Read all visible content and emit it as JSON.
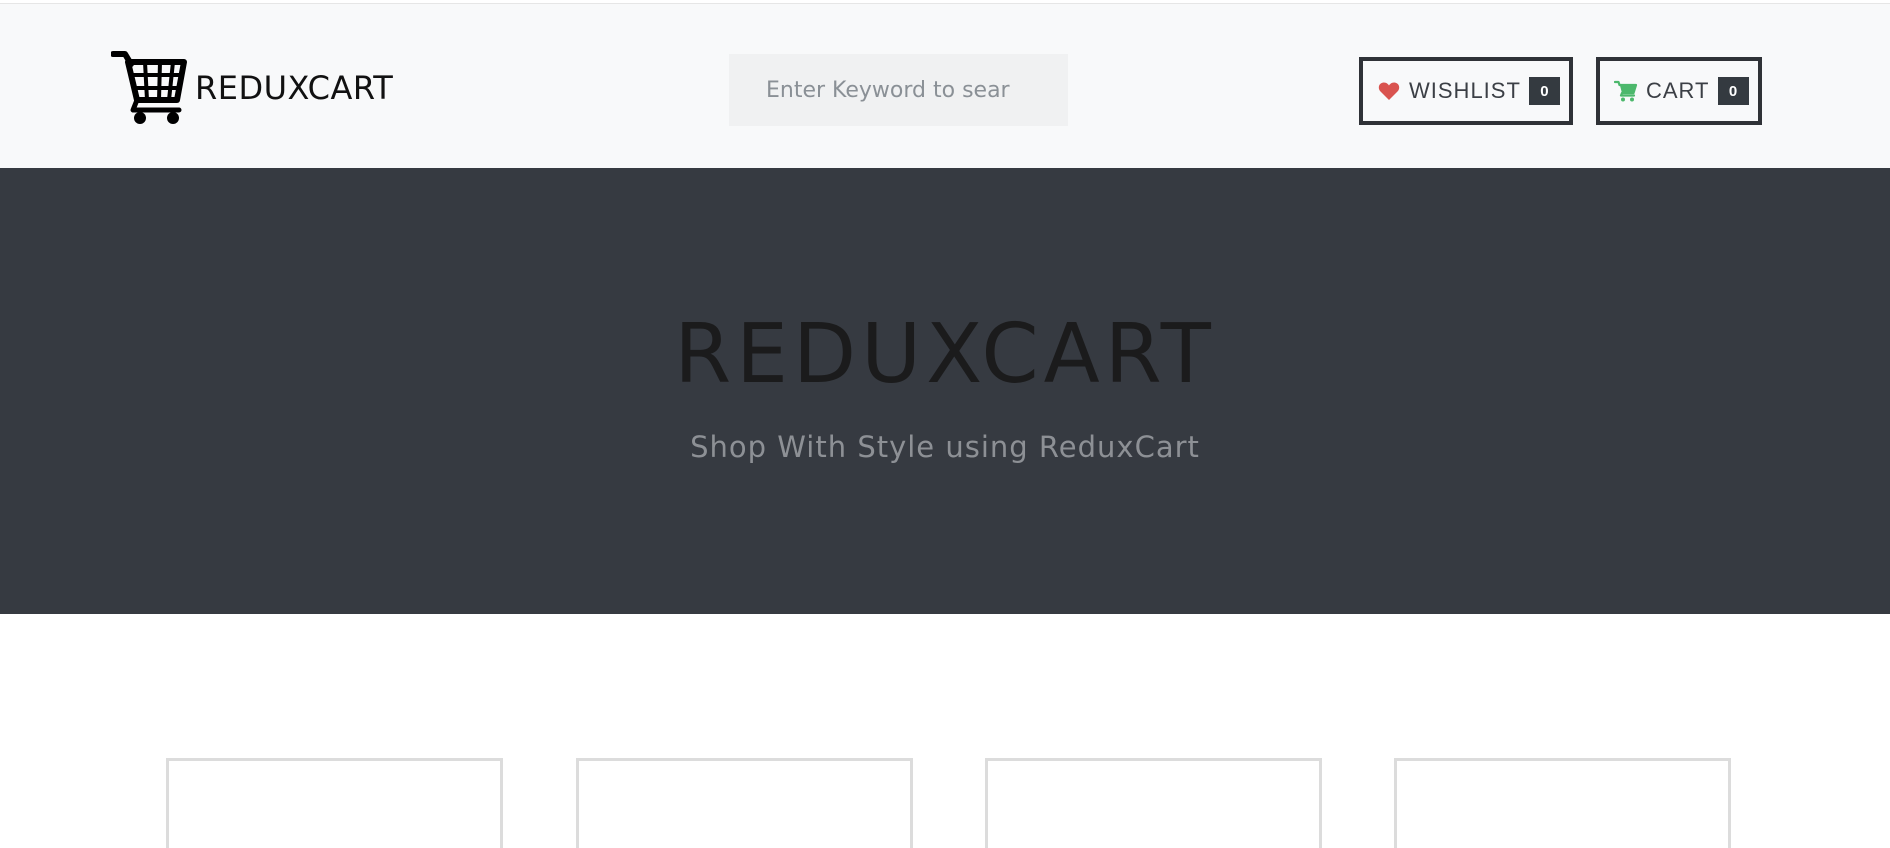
{
  "header": {
    "brand": "REDUXCART",
    "search": {
      "placeholder": "Enter Keyword to search",
      "value": ""
    },
    "wishlist": {
      "label": "WISHLIST",
      "count": "0",
      "icon": "heart-icon",
      "icon_color": "#d9534f"
    },
    "cart": {
      "label": "CART",
      "count": "0",
      "icon": "cart-icon",
      "icon_color": "#4cb86c"
    },
    "logo_icon": "shopping-cart-logo"
  },
  "hero": {
    "title": "REDUXCART",
    "subtitle": "Shop With Style using ReduxCart"
  },
  "products": {
    "cards": [
      {},
      {},
      {},
      {}
    ]
  },
  "colors": {
    "navbar_bg": "#f8f9fa",
    "hero_bg": "#363a41",
    "badge_bg": "#343a40"
  }
}
